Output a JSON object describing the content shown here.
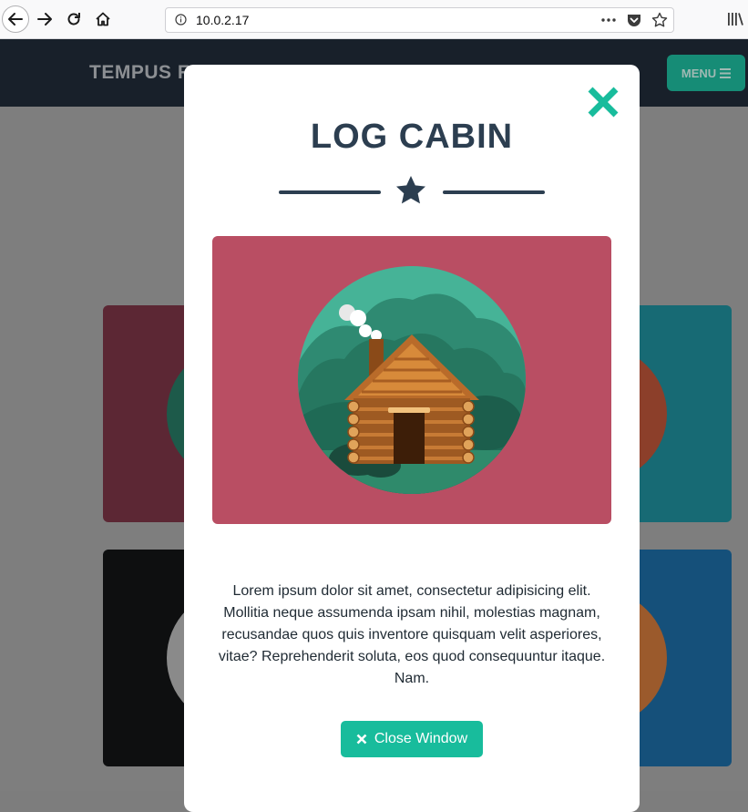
{
  "browser": {
    "url": "10.0.2.17",
    "icons": [
      "back-icon",
      "forward-icon",
      "reload-icon",
      "home-icon",
      "info-icon",
      "more-icon",
      "pocket-icon",
      "bookmark-star-icon",
      "library-icon"
    ]
  },
  "site": {
    "brand": "TEMPUS F",
    "menu_label": "MENU"
  },
  "modal": {
    "title": "LOG CABIN",
    "description": "Lorem ipsum dolor sit amet, consectetur adipisicing elit. Mollitia neque assumenda ipsam nihil, molestias magnam, recusandae quos quis inventore quisquam velit asperiores, vitae? Reprehenderit soluta, eos quod consequuntur itaque. Nam.",
    "close_button_label": "Close Window"
  },
  "colors": {
    "accent": "#18bc9c",
    "heading": "#2c3e50",
    "image_bg": "#b94e63",
    "navbar": "#2c3e50"
  }
}
